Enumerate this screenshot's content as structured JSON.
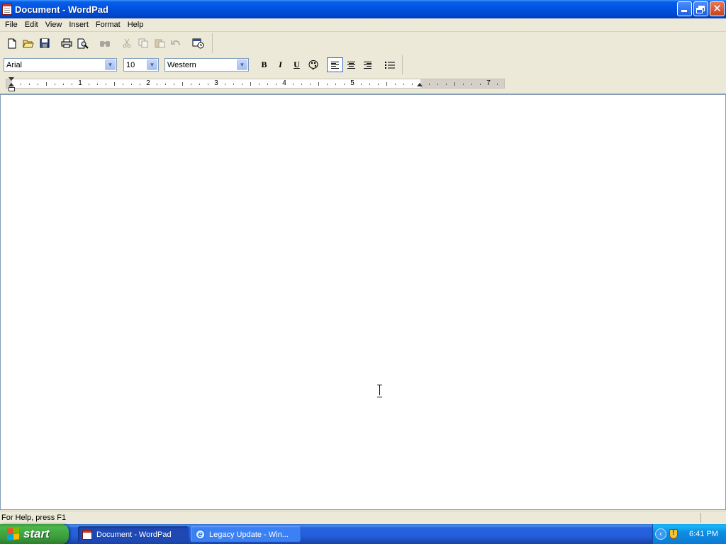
{
  "window": {
    "title": "Document - WordPad"
  },
  "menu": [
    "File",
    "Edit",
    "View",
    "Insert",
    "Format",
    "Help"
  ],
  "toolbar": {
    "buttons": [
      "new-icon",
      "open-icon",
      "save-icon",
      "print-icon",
      "print-preview-icon",
      "find-icon",
      "cut-icon",
      "copy-icon",
      "paste-icon",
      "undo-icon",
      "date-time-icon"
    ]
  },
  "format_bar": {
    "font": "Arial",
    "size": "10",
    "script": "Western",
    "bold_label": "B",
    "italic_label": "I",
    "underline_label": "U"
  },
  "ruler": {
    "numbers": [
      "1",
      "2",
      "3",
      "4",
      "5",
      "7"
    ]
  },
  "status": {
    "help_text": "For Help, press F1"
  },
  "taskbar": {
    "start_label": "start",
    "tasks": [
      {
        "label": "Document - WordPad",
        "active": true
      },
      {
        "label": "Legacy Update - Win...",
        "active": false
      }
    ],
    "clock": "6:41 PM"
  },
  "colors": {
    "titlebar": "#0054e3",
    "taskbar": "#245edb",
    "start": "#3a9a3a",
    "chrome": "#ece9d8"
  }
}
